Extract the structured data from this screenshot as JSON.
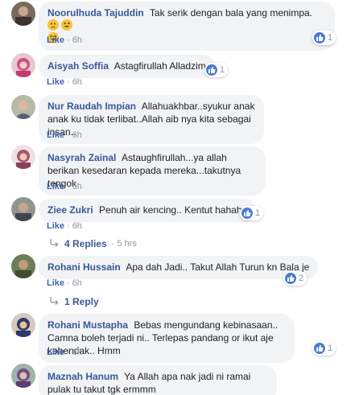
{
  "comments": [
    {
      "name": "Noorulhuda Tajuddin",
      "text": "Tak serik dengan bala yang menimpa.",
      "like": "Like",
      "time": "6h",
      "reactions": "1"
    },
    {
      "name": "Aisyah Soffia",
      "text": "Astagfirullah Alladzim",
      "like": "Like",
      "time": "6h",
      "reactions": "1"
    },
    {
      "name": "Nur Raudah Impian",
      "text": "Allahuakhbar..syukur anak anak ku tidak terlibat..Allah aib nya kita sebagai insan..",
      "like": "Like",
      "time": "6h"
    },
    {
      "name": "Nasyrah Zainal",
      "text": "Astaughfirullah...ya allah berikan kesedaran kepada mereka...takutnya tengok",
      "like": "Like",
      "time": "6h"
    },
    {
      "name": "Ziee Zukri",
      "text": "Penuh air kencing.. Kentut hahaha",
      "like": "Like",
      "time": "6h",
      "reactions": "1",
      "replies": "4 Replies",
      "replies_time": "5 hrs"
    },
    {
      "name": "Rohani Hussain",
      "text": "Apa dah Jadi.. Takut Allah Turun kn Bala je",
      "like": "Like",
      "time": "6h",
      "reactions": "2",
      "replies": "1 Reply"
    },
    {
      "name": "Rohani Mustapha",
      "text": "Bebas mengundang kebinasaan.. Camna boleh terjadi ni.. Terlepas pandang or ikut aje kehendak.. Hmm",
      "like": "Like",
      "time": "6h",
      "reactions": "1"
    },
    {
      "name": "Maznah Hanum",
      "text": "Ya Allah apa nak jadi ni ramai pulak tu takut tgk ermmm"
    }
  ],
  "colors": {
    "name": "#385898",
    "bubble": "#f2f3f5",
    "meta": "#90949c",
    "like_icon": "#4a7bd6"
  },
  "icons": {
    "reaction": "thumbs-up-icon",
    "reply": "reply-arrow-icon"
  }
}
